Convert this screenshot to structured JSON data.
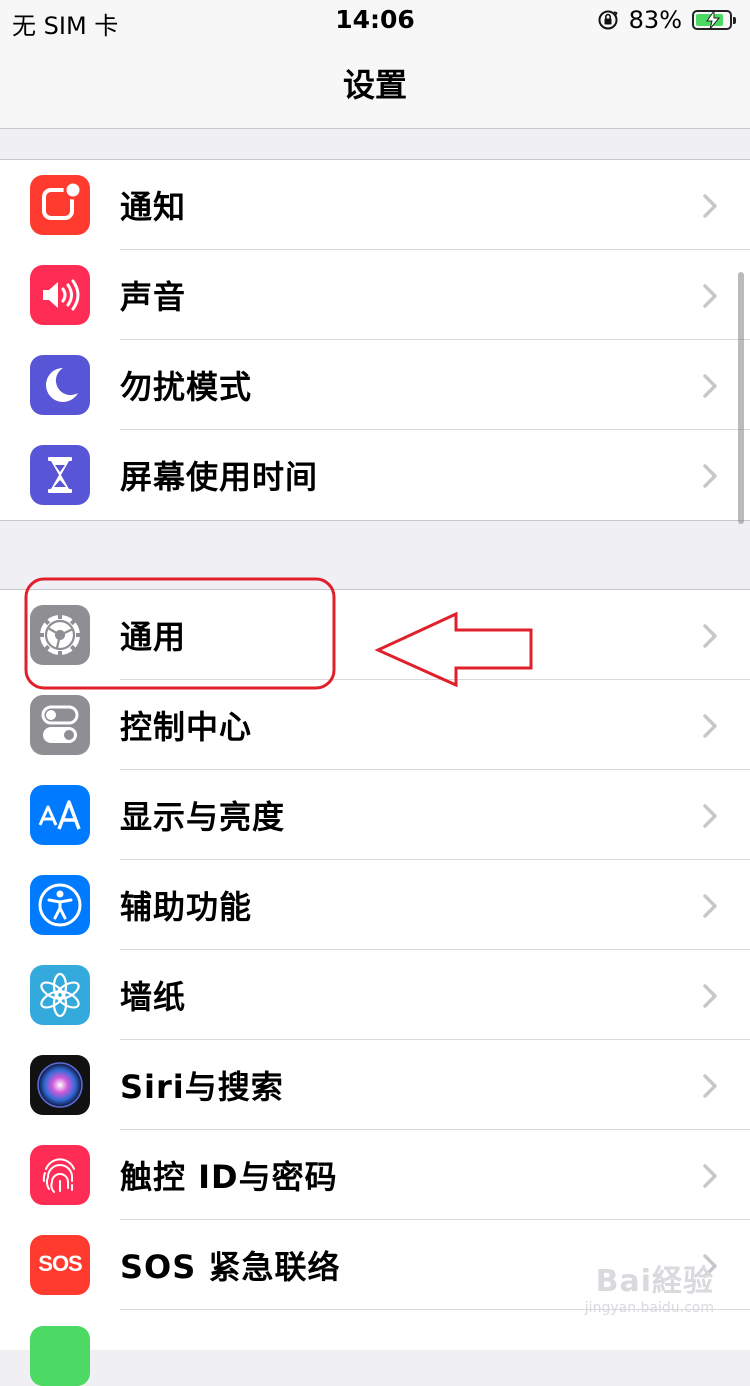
{
  "status": {
    "carrier": "无 SIM 卡",
    "time": "14:06",
    "battery": "83%",
    "battery_level": 0.83
  },
  "nav": {
    "title": "设置"
  },
  "group1": [
    {
      "label": "通知",
      "icon": "notifications-icon",
      "color": "#ff3b30"
    },
    {
      "label": "声音",
      "icon": "sounds-icon",
      "color": "#ff2d55"
    },
    {
      "label": "勿扰模式",
      "icon": "moon-icon",
      "color": "#5856d6"
    },
    {
      "label": "屏幕使用时间",
      "icon": "hourglass-icon",
      "color": "#5856d6"
    }
  ],
  "group2": [
    {
      "label": "通用",
      "icon": "gear-icon",
      "color": "#8e8e93"
    },
    {
      "label": "控制中心",
      "icon": "toggles-icon",
      "color": "#8e8e93"
    },
    {
      "label": "显示与亮度",
      "icon": "text-size-icon",
      "color": "#007aff"
    },
    {
      "label": "辅助功能",
      "icon": "accessibility-icon",
      "color": "#007aff"
    },
    {
      "label": "墙纸",
      "icon": "flower-icon",
      "color": "#34aadc"
    },
    {
      "label": "Siri与搜索",
      "icon": "siri-icon",
      "color": "#1c1c3c"
    },
    {
      "label": "触控 ID与密码",
      "icon": "fingerprint-icon",
      "color": "#ff2d55"
    },
    {
      "label": "SOS 紧急联络",
      "icon": "sos-icon",
      "color": "#ff3b30"
    }
  ],
  "sos_icon_text": "SOS",
  "watermark": {
    "line1": "Bai経验",
    "line2": "jingyan.baidu.com"
  },
  "annotation_color": "#e0202a"
}
